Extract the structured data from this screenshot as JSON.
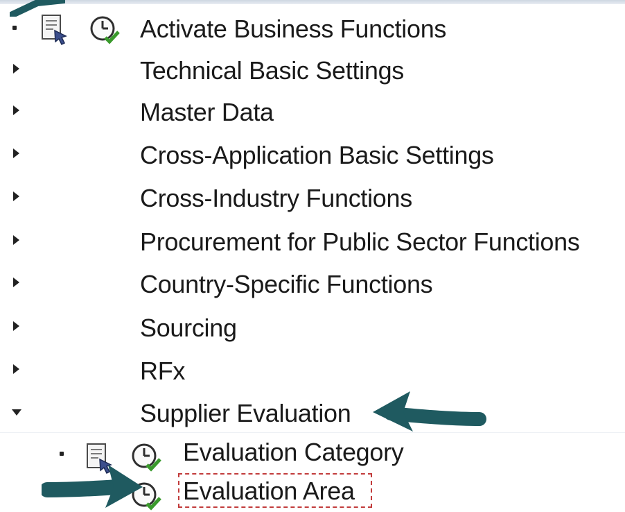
{
  "tree": {
    "items": [
      {
        "label": "Activate Business Functions"
      },
      {
        "label": "Technical Basic Settings"
      },
      {
        "label": "Master Data"
      },
      {
        "label": "Cross-Application Basic Settings"
      },
      {
        "label": "Cross-Industry Functions"
      },
      {
        "label": "Procurement for Public Sector Functions"
      },
      {
        "label": "Country-Specific Functions"
      },
      {
        "label": "Sourcing"
      },
      {
        "label": "RFx"
      },
      {
        "label": "Supplier Evaluation"
      }
    ],
    "children": [
      {
        "label": "Evaluation Category"
      },
      {
        "label": "Evaluation Area"
      }
    ]
  },
  "icons": {
    "activity": "documentation-icon",
    "execute": "execute-clock-icon",
    "pointer": "arrow-icon"
  },
  "colors": {
    "arrow": "#1f5a60",
    "clock_green": "#3a9a2c",
    "focus_border": "#c23c3c"
  }
}
